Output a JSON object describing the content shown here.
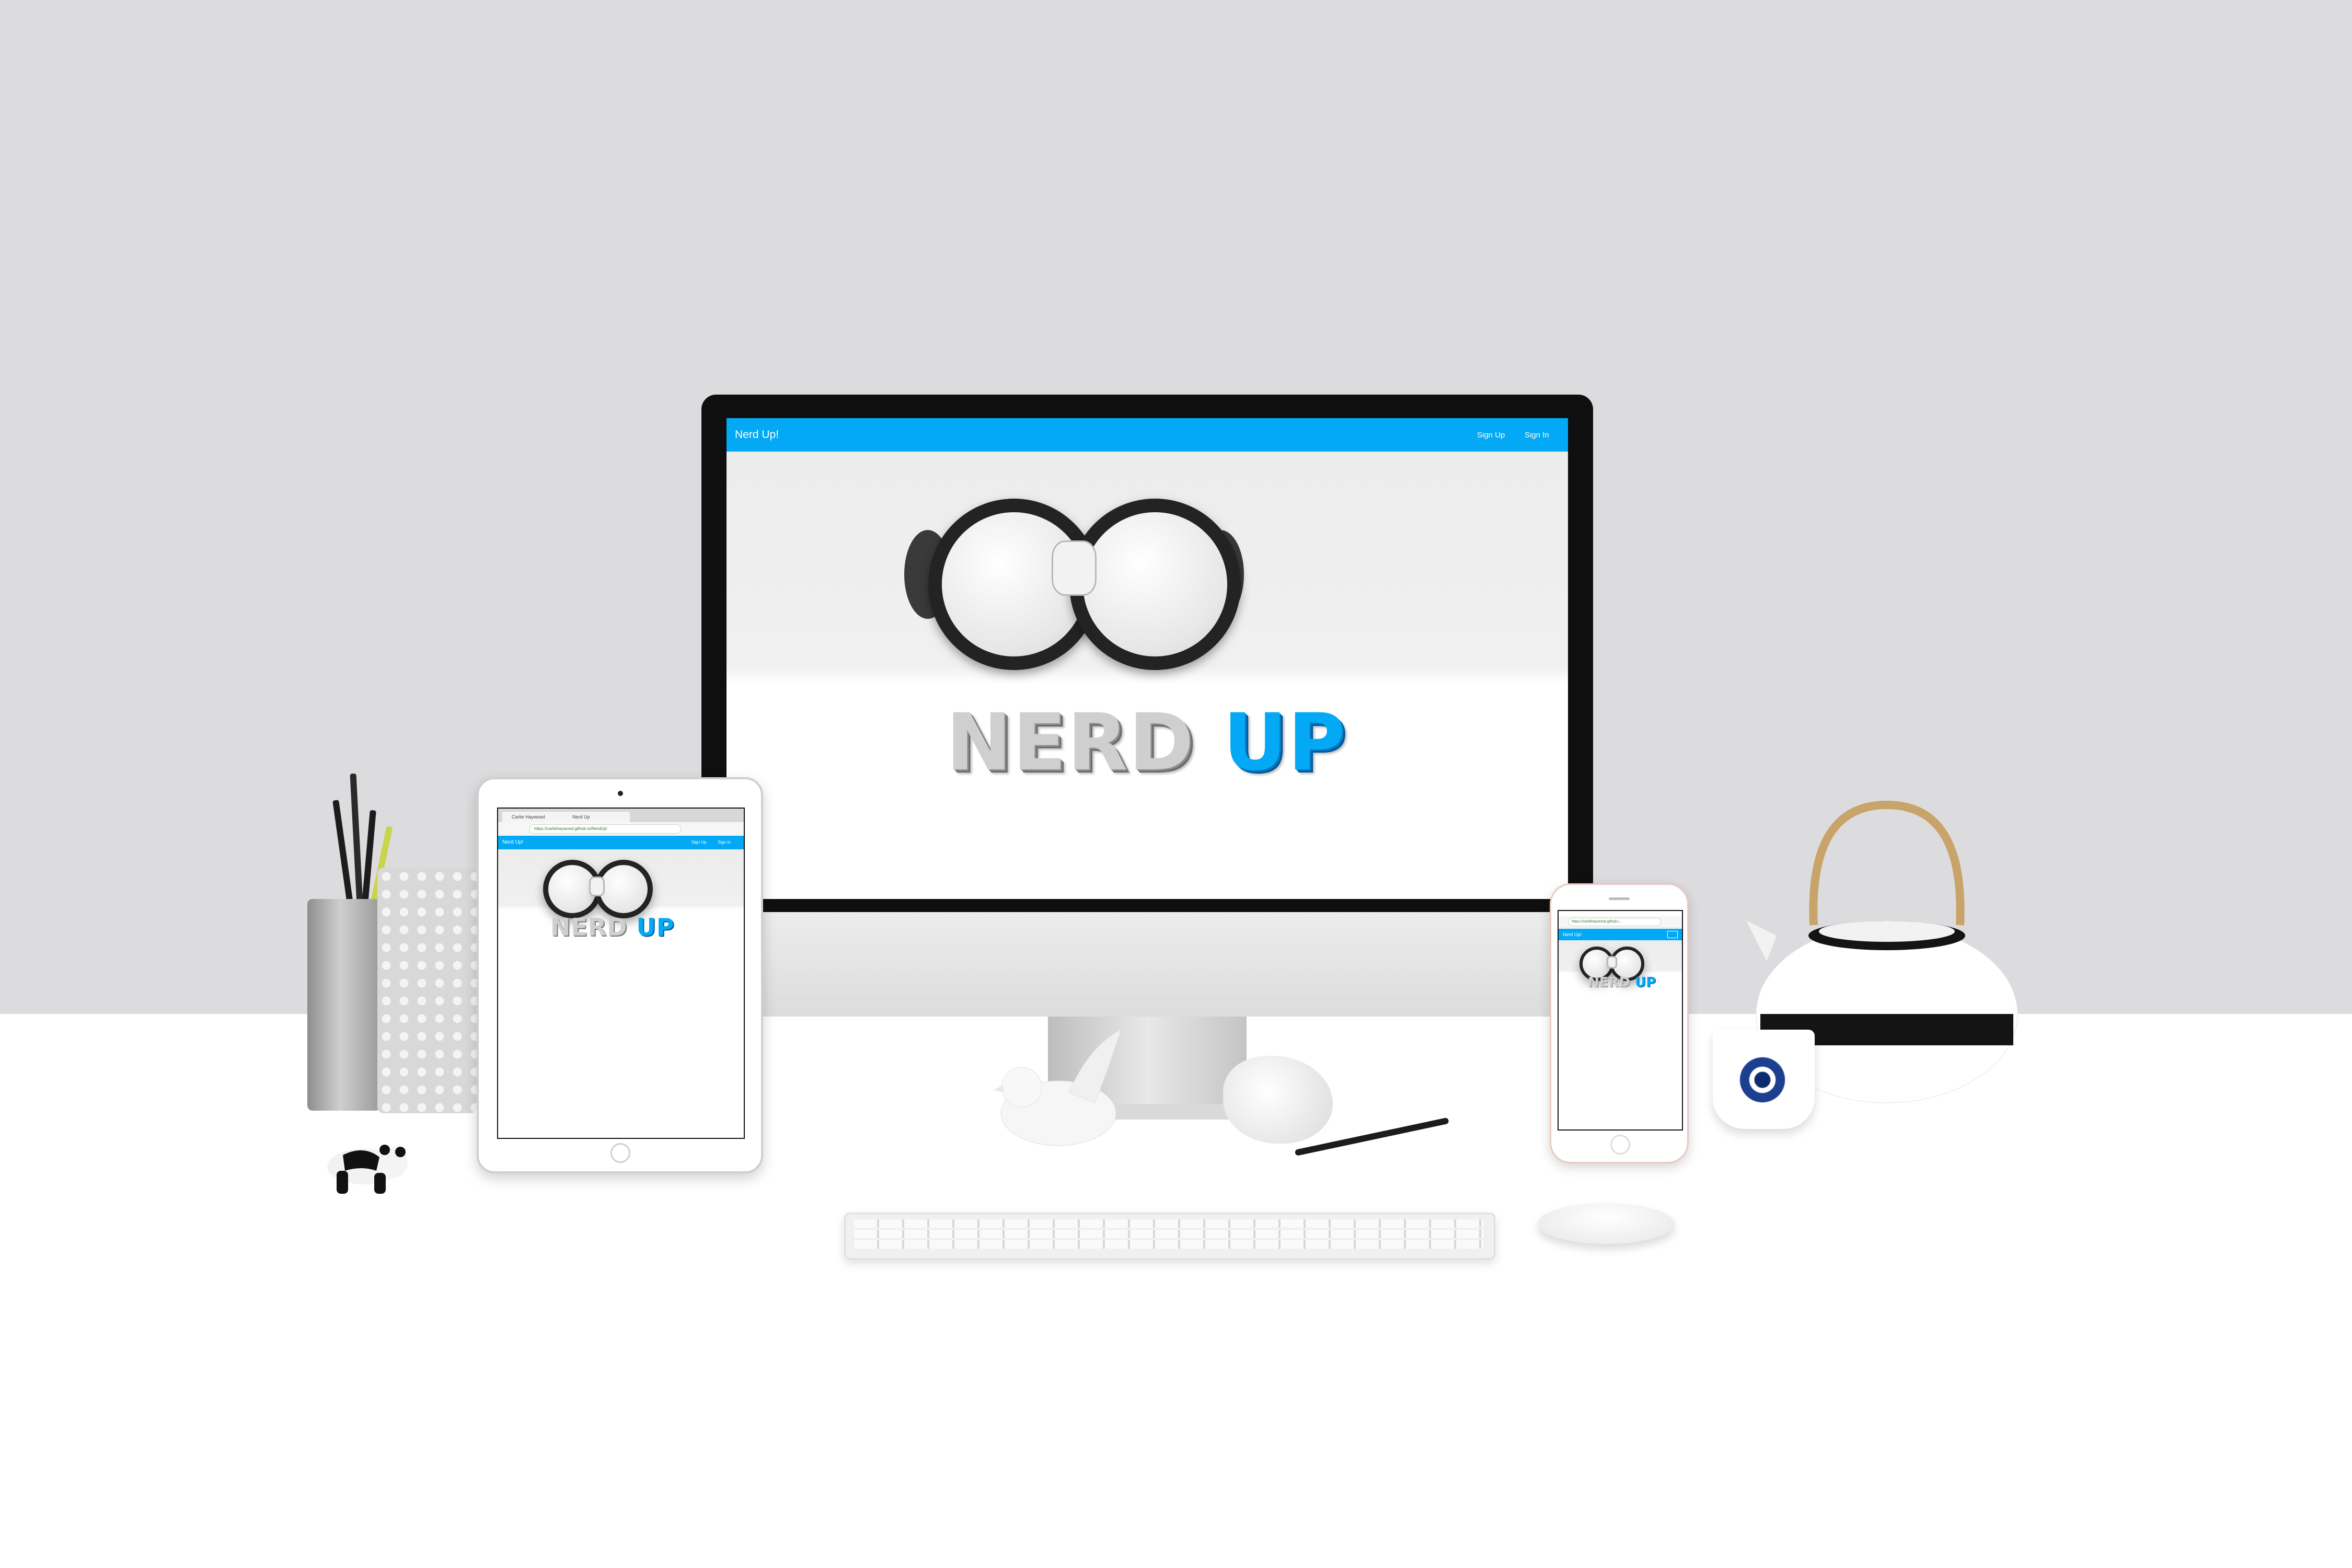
{
  "site": {
    "brand": "Nerd Up!",
    "nav_links": [
      "Sign Up",
      "Sign In"
    ],
    "logo_word_1": "NERD",
    "logo_word_2": "UP",
    "navbar_color": "#03a9f4"
  },
  "tablet_browser": {
    "tab_1": "Carlie Haywood",
    "tab_2": "Nerd Up",
    "url": "https://carliehaywood.github.io/NerdUp/",
    "nav_brand": "Nerd Up!",
    "nav_links": [
      "Sign Up",
      "Sign In"
    ]
  },
  "phone_browser": {
    "url": "https://carliehaywood.github.i...",
    "nav_brand": "Nerd Up!"
  },
  "icons": {
    "apple": "apple-logo-icon",
    "home": "home-button-icon"
  }
}
